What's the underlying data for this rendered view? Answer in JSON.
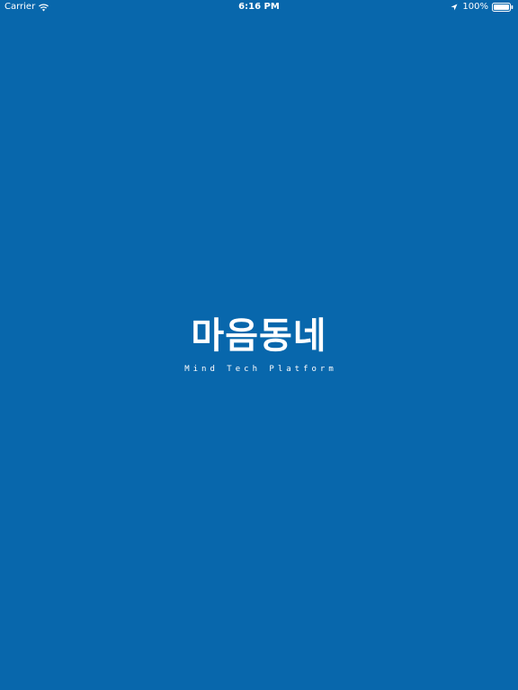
{
  "status_bar": {
    "carrier": "Carrier",
    "time": "6:16 PM",
    "battery": "100%",
    "icons": [
      "wifi-icon",
      "location-icon",
      "battery-icon"
    ]
  },
  "splash": {
    "title": "마음동네",
    "tagline": "Mind Tech Platform"
  },
  "colors": {
    "background": "#0867ac",
    "text": "#ffffff"
  }
}
